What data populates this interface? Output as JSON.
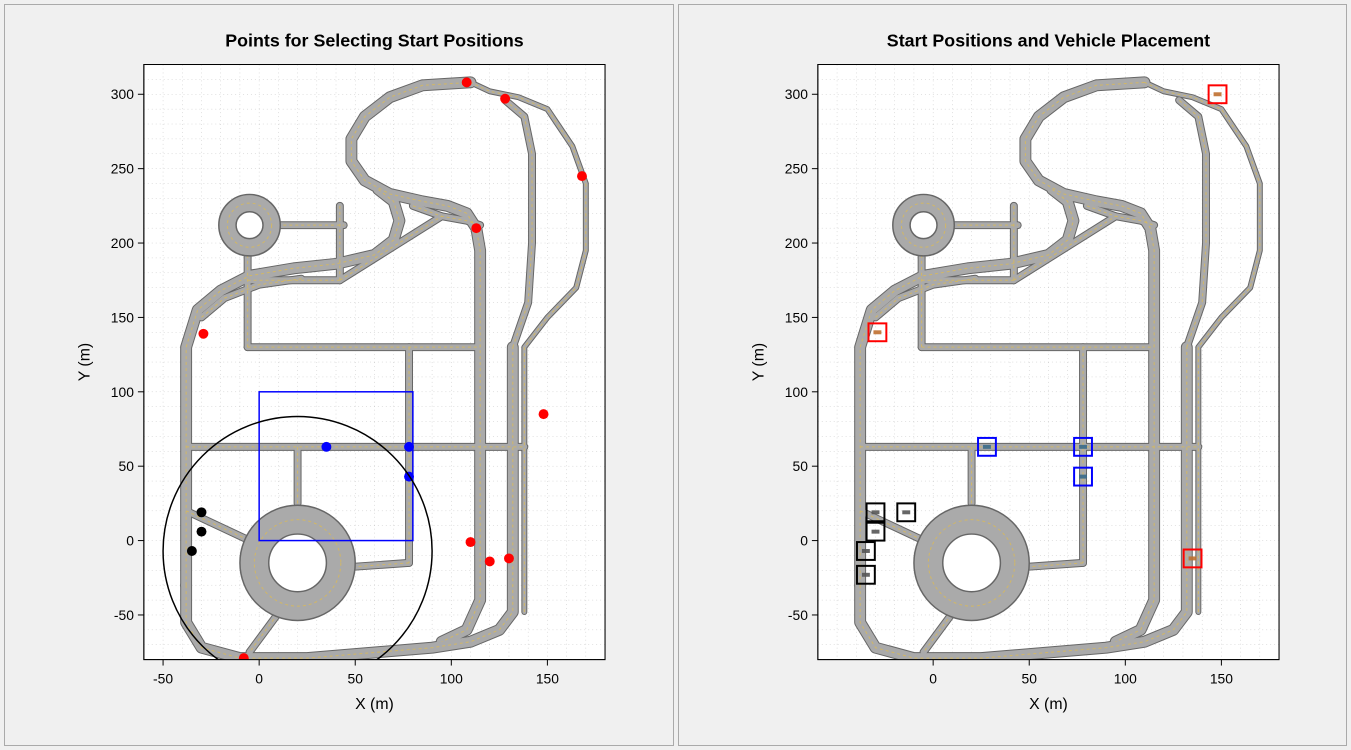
{
  "chart_data": [
    {
      "type": "scatter",
      "title": "Points for Selecting Start Positions",
      "xlabel": "X (m)",
      "ylabel": "Y (m)",
      "xlim": [
        -60,
        180
      ],
      "ylim": [
        -80,
        320
      ],
      "xticks": [
        -50,
        0,
        50,
        100,
        150
      ],
      "yticks": [
        -50,
        0,
        50,
        100,
        150,
        200,
        250,
        300
      ],
      "grid_minor_step": 10,
      "series": [
        {
          "name": "scenario-region-points-red",
          "color": "#ff0000",
          "marker": "circle-filled",
          "points": [
            {
              "x": 108,
              "y": 308
            },
            {
              "x": 128,
              "y": 297
            },
            {
              "x": 168,
              "y": 245
            },
            {
              "x": 113,
              "y": 210
            },
            {
              "x": -29,
              "y": 139
            },
            {
              "x": 148,
              "y": 85
            },
            {
              "x": 110,
              "y": -1
            },
            {
              "x": 120,
              "y": -14
            },
            {
              "x": 130,
              "y": -12
            },
            {
              "x": -8,
              "y": -79
            }
          ]
        },
        {
          "name": "rectangle-region-points-blue",
          "color": "#0000ff",
          "marker": "circle-filled",
          "points": [
            {
              "x": 35,
              "y": 63
            },
            {
              "x": 78,
              "y": 63
            },
            {
              "x": 78,
              "y": 43
            }
          ]
        },
        {
          "name": "rectangle-region-blue",
          "color": "#0000ff",
          "type": "rect",
          "rect": {
            "xmin": 0,
            "xmax": 80,
            "ymin": 0,
            "ymax": 100
          }
        },
        {
          "name": "circle-region-points-black",
          "color": "#000000",
          "marker": "circle-filled",
          "points": [
            {
              "x": -30,
              "y": 19
            },
            {
              "x": -30,
              "y": 6
            },
            {
              "x": -35,
              "y": -7
            }
          ]
        },
        {
          "name": "circle-region-black",
          "color": "#000000",
          "type": "circle",
          "circle": {
            "cx": 20,
            "cy": -7,
            "r": 70
          }
        }
      ],
      "road_map": "large-test-track"
    },
    {
      "type": "scatter",
      "title": "Start Positions and Vehicle Placement",
      "xlabel": "X (m)",
      "ylabel": "Y (m)",
      "xlim": [
        -60,
        180
      ],
      "ylim": [
        -80,
        320
      ],
      "xticks": [
        0,
        50,
        100,
        150
      ],
      "yticks": [
        -50,
        0,
        50,
        100,
        150,
        200,
        250,
        300
      ],
      "grid_minor_step": 10,
      "series": [
        {
          "name": "selected-vehicles-red",
          "color": "#ff0000",
          "marker": "square-open",
          "points": [
            {
              "x": 148,
              "y": 300
            },
            {
              "x": -29,
              "y": 140
            },
            {
              "x": 135,
              "y": -12
            }
          ]
        },
        {
          "name": "selected-vehicles-blue",
          "color": "#0000ff",
          "marker": "square-open",
          "points": [
            {
              "x": 28,
              "y": 63
            },
            {
              "x": 78,
              "y": 63
            },
            {
              "x": 78,
              "y": 43
            }
          ]
        },
        {
          "name": "selected-vehicles-black",
          "color": "#000000",
          "marker": "square-open",
          "points": [
            {
              "x": -30,
              "y": 19
            },
            {
              "x": -14,
              "y": 19
            },
            {
              "x": -30,
              "y": 6
            },
            {
              "x": -35,
              "y": -7
            },
            {
              "x": -35,
              "y": -23
            }
          ]
        }
      ],
      "road_map": "large-test-track"
    }
  ]
}
